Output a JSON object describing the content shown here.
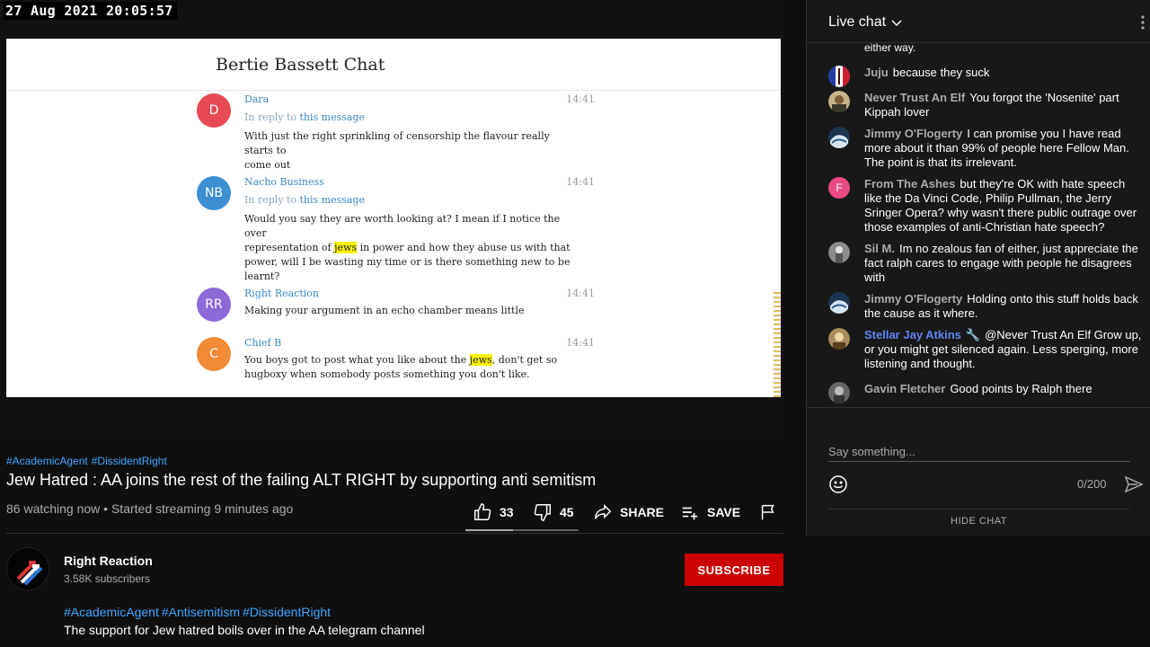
{
  "overlay": {
    "timestamp": "27 Aug 2021 20:05:57"
  },
  "video_frame": {
    "chat_title": "Bertie Bassett Chat",
    "messages": [
      {
        "initials": "D",
        "name": "Dara",
        "time": "14:41",
        "reply_prefix": "In reply to ",
        "reply_link": "this message",
        "text_lines": [
          "With just the right sprinkling of censorship the flavour really starts to",
          "come out"
        ]
      },
      {
        "initials": "NB",
        "name": "Nacho Business",
        "time": "14:41",
        "reply_prefix": "In reply to ",
        "reply_link": "this message",
        "line1": "Would you say they are worth looking at? I mean if I notice the over",
        "line2_a": "representation of ",
        "line2_hl": "jews",
        "line2_b": " in power and how they abuse us with that",
        "line3": "power, will I be wasting my time or is there something new to be",
        "line4": "learnt?"
      },
      {
        "initials": "RR",
        "name": "Right Reaction",
        "time": "14:41",
        "text": "Making your argument in an echo chamber means little"
      },
      {
        "initials": "C",
        "name": "Chief B",
        "time": "14:41",
        "line1_a": "You boys got to post what you like about the ",
        "line1_hl": "jews",
        "line1_b": ", don't get so",
        "line2": "hugboxy when somebody posts something you don't like."
      }
    ],
    "avatar_colors": {
      "D": "#e84a55",
      "NB": "#3d8fd1",
      "RR": "#8e6ad8",
      "C": "#f28a36"
    }
  },
  "video": {
    "tags": [
      "#AcademicAgent",
      "#DissidentRight"
    ],
    "title": "Jew Hatred : AA joins the rest of the failing ALT RIGHT by supporting anti semitism",
    "view_info": "86 watching now • Started streaming 9 minutes ago",
    "likes": "33",
    "dislikes": "45",
    "like_ratio": 0.42,
    "share_label": "SHARE",
    "save_label": "SAVE"
  },
  "channel": {
    "name": "Right Reaction",
    "subscribers": "3.58K subscribers",
    "subscribe_label": "SUBSCRIBE",
    "description_tags": [
      "#AcademicAgent",
      "#Antisemitism",
      "#DissidentRight"
    ],
    "description": "The support for Jew hatred boils over in the AA telegram channel"
  },
  "live_chat": {
    "header": "Live chat",
    "truncated_message": "either way.",
    "messages": [
      {
        "author": "Juju",
        "text": "because they suck",
        "avatar": "flag-fr"
      },
      {
        "author": "Never Trust An Elf",
        "text": "You forgot the 'Nosenite' part Kippah lover",
        "avatar": "photo"
      },
      {
        "author": "Jimmy O'Flogerty",
        "text": "I can promise you I have read more about it than 99% of people here Fellow Man. The point is that its irrelevant.",
        "avatar": "wave"
      },
      {
        "author": "From The Ashes",
        "text": "but they're OK with hate speech like the Da Vinci Code, Philip Pullman, the Jerry Sringer Opera? why wasn't there public outrage over those examples of anti-Christian hate speech?",
        "avatar": "letter",
        "initial": "F"
      },
      {
        "author": "Sil M.",
        "text": "Im no zealous fan of either, just appreciate the fact ralph cares to engage with people he disagrees with",
        "avatar": "gray"
      },
      {
        "author": "Jimmy O'Flogerty",
        "text": "Holding onto this stuff holds back the cause as it where.",
        "avatar": "wave"
      },
      {
        "author": "Stellar Jay Atkins",
        "text": "@Never Trust An Elf Grow up, or you might get silenced again. Less sperging, more listening and thought.",
        "avatar": "photo2",
        "moderator": true
      },
      {
        "author": "Gavin Fletcher",
        "text": "Good points by Ralph there",
        "avatar": "gray2"
      }
    ],
    "input_placeholder": "Say something...",
    "char_count": "0/200",
    "hide_label": "HIDE CHAT"
  }
}
